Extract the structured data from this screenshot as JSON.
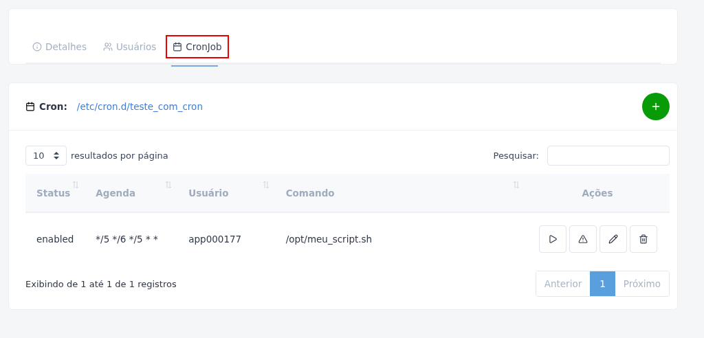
{
  "tabs": [
    {
      "label": "Detalhes",
      "selected": false,
      "highlighted": false
    },
    {
      "label": "Usuários",
      "selected": false,
      "highlighted": false
    },
    {
      "label": "CronJob",
      "selected": true,
      "highlighted": true
    }
  ],
  "cron": {
    "label": "Cron:",
    "path": "/etc/cron.d/teste_com_cron"
  },
  "page_size": {
    "value": "10",
    "label": "resultados por página"
  },
  "search": {
    "label": "Pesquisar:"
  },
  "table": {
    "columns": [
      {
        "label": "Status",
        "sortable": true
      },
      {
        "label": "Agenda",
        "sortable": true
      },
      {
        "label": "Usuário",
        "sortable": true
      },
      {
        "label": "Comando",
        "sortable": true
      },
      {
        "label": "Ações",
        "sortable": false
      }
    ],
    "rows": [
      {
        "cells": [
          "enabled",
          "*/5 */6 */5 * *",
          "app000177",
          "/opt/meu_script.sh"
        ]
      }
    ]
  },
  "info": "Exibindo de 1 até 1 de 1 registros",
  "pagination": [
    {
      "label": "Anterior",
      "selected": false
    },
    {
      "label": "1",
      "selected": true
    },
    {
      "label": "Próximo",
      "selected": false
    }
  ]
}
